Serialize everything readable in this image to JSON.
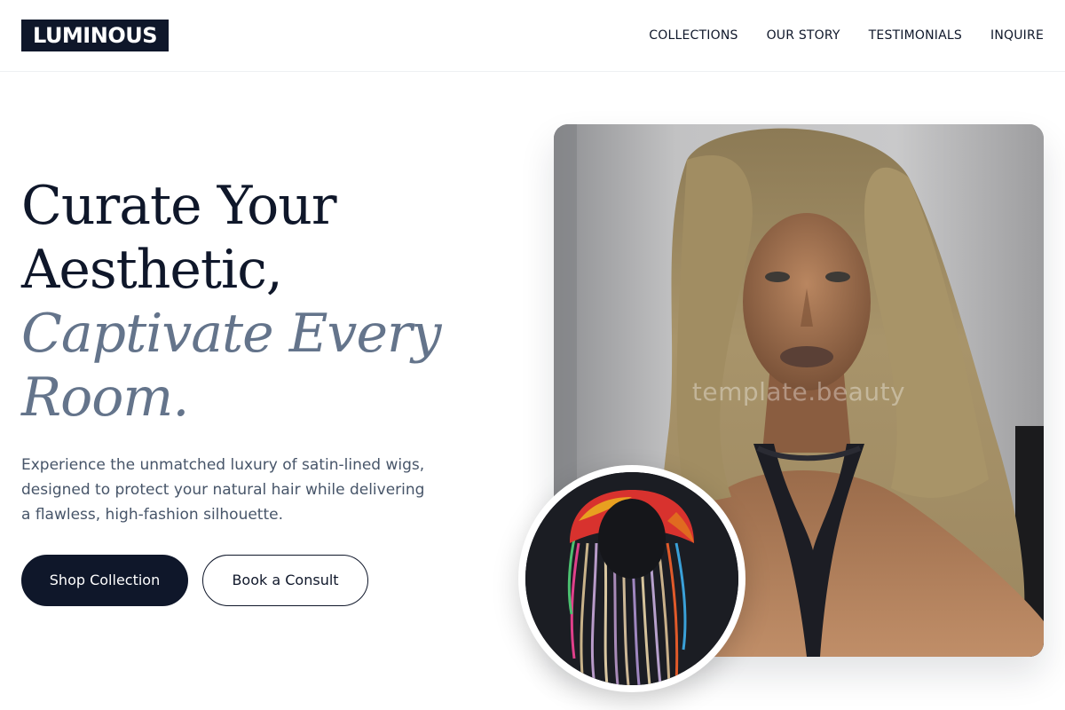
{
  "brand": {
    "logo_text": "LUMINOUS"
  },
  "nav": {
    "items": [
      {
        "label": "COLLECTIONS"
      },
      {
        "label": "OUR STORY"
      },
      {
        "label": "TESTIMONIALS"
      },
      {
        "label": "INQUIRE"
      }
    ]
  },
  "hero": {
    "headline_line1": "Curate Your",
    "headline_line2": "Aesthetic,",
    "headline_accent1": "Captivate Every",
    "headline_accent2": "Room.",
    "description": "Experience the unmatched luxury of satin-lined wigs, designed to protect your natural hair while delivering a flawless, high-fashion silhouette.",
    "primary_button": "Shop Collection",
    "secondary_button": "Book a Consult",
    "image_watermark": "template.beauty"
  },
  "colors": {
    "primary": "#0f172a",
    "accent_text": "#64748b",
    "body_text": "#475569"
  },
  "icons": {
    "hero_photo": "mannequin-blonde-wig-image",
    "inset_photo": "rainbow-braided-wig-image"
  }
}
